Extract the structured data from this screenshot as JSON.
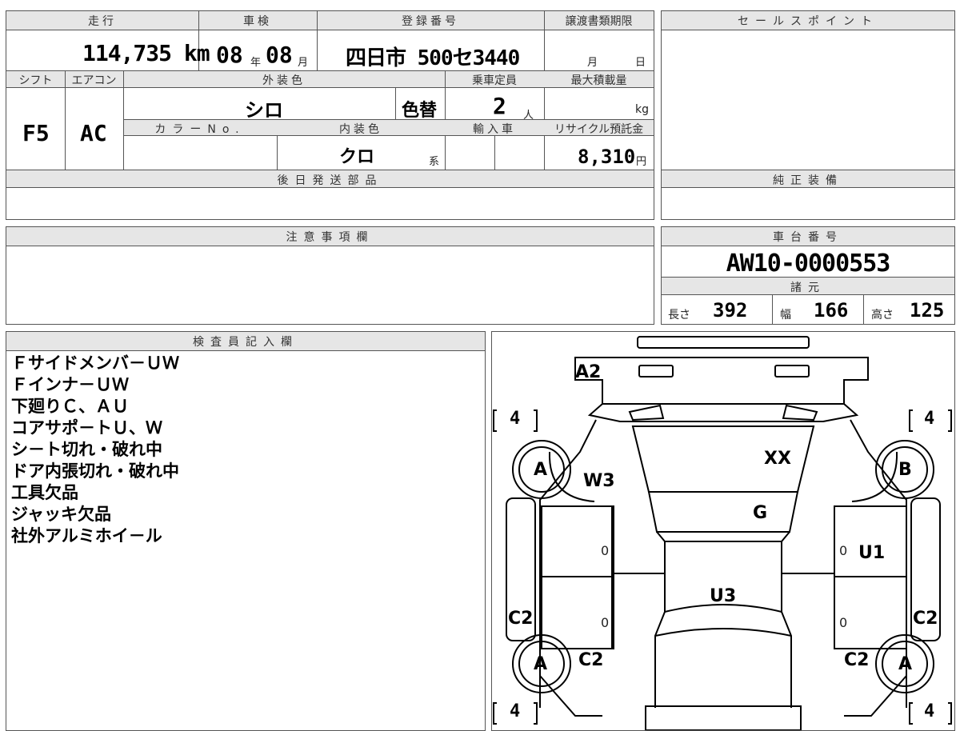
{
  "top": {
    "mileage_label": "走行",
    "mileage_value": "114,735 km",
    "shaken_label": "車検",
    "shaken_year": "08",
    "shaken_year_unit": "年",
    "shaken_month": "08",
    "shaken_month_unit": "月",
    "reg_label": "登録番号",
    "reg_value": "四日市 500セ3440",
    "transfer_label": "譲渡書類期限",
    "transfer_month": "月",
    "transfer_day": "日",
    "shift_label": "シフト",
    "shift_value": "F5",
    "ac_label": "エアコン",
    "ac_value": "AC",
    "exterior_label": "外装色",
    "exterior_value": "シロ",
    "color_change": "色替",
    "capacity_label": "乗車定員",
    "capacity_value": "2",
    "capacity_unit": "人",
    "load_label": "最大積載量",
    "load_unit": "kg",
    "colorno_label": "カラーNo.",
    "interior_label": "内装色",
    "interior_value": "クロ",
    "interior_suffix": "系",
    "import_label": "輸入車",
    "recycle_label": "リサイクル預託金",
    "recycle_value": "8,310",
    "recycle_unit": "円",
    "later_parts_label": "後日発送部品"
  },
  "right": {
    "sales_point_label": "セールスポイント",
    "genuine_equip_label": "純正装備",
    "chassis_label": "車台番号",
    "chassis_value": "AW10-0000553",
    "specs_label": "諸元",
    "length_label": "長さ",
    "length_value": "392",
    "width_label": "幅",
    "width_value": "166",
    "height_label": "高さ",
    "height_value": "125"
  },
  "notes": {
    "caution_label": "注意事項欄",
    "inspector_label": "検査員記入欄",
    "inspector_lines": [
      "Ｆサイドメンバ－ＵＷ",
      "Ｆインナ－ＵＷ",
      "下廻りＣ、ＡＵ",
      "コアサポ－トＵ、Ｗ",
      "シ－ト切れ・破れ中",
      "ドア内張切れ・破れ中",
      "工具欠品",
      "ジャッキ欠品",
      "社外アルミホイ－ル"
    ]
  },
  "diagram": {
    "tire_fl": "4",
    "tire_fr": "4",
    "tire_rl": "4",
    "tire_rr": "4",
    "wheel_fl": "A",
    "wheel_fr": "B",
    "wheel_rl": "A",
    "wheel_rr": "A",
    "mark_a2": "A2",
    "mark_w3": "W3",
    "mark_xx": "XX",
    "mark_g": "G",
    "mark_u1": "U1",
    "mark_u3": "U3",
    "mark_c2_left": "C2",
    "mark_c2_right": "C2",
    "mark_c2_rear_left": "C2",
    "mark_c2_rear_right": "C2",
    "door_zero_1": "0",
    "door_zero_2": "0",
    "door_zero_3": "0",
    "door_zero_4": "0"
  }
}
